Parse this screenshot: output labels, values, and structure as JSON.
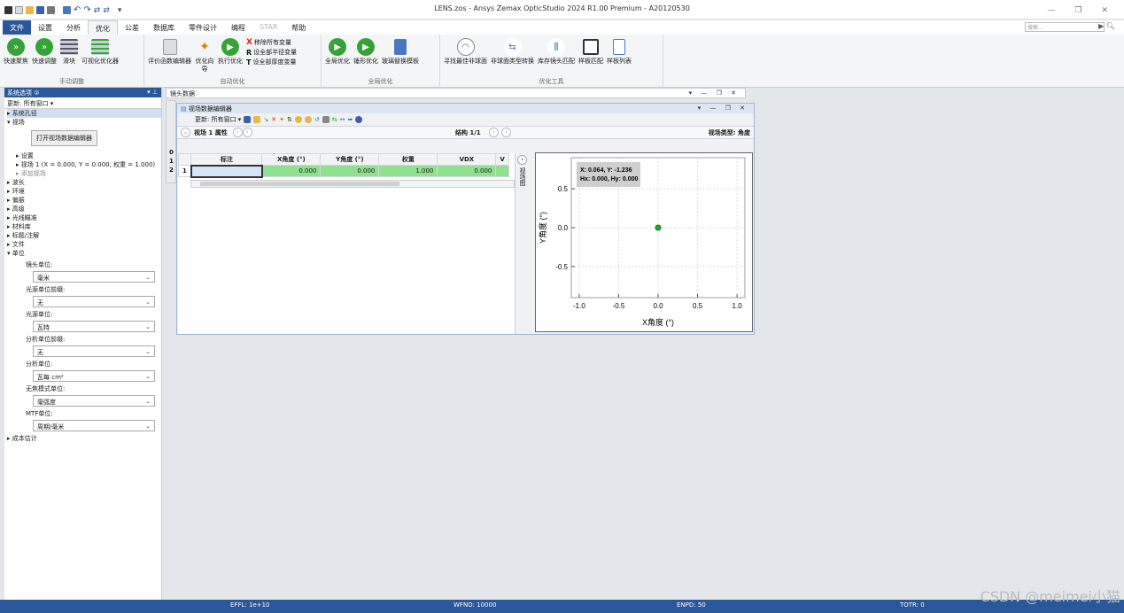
{
  "window": {
    "title": "LENS.zos - Ansys Zemax OpticStudio 2024 R1.00   Premium - A20120530"
  },
  "tabs": [
    "文件",
    "设置",
    "分析",
    "优化",
    "公差",
    "数据库",
    "零件设计",
    "编程",
    "STAR",
    "帮助"
  ],
  "search_placeholder": "搜索...",
  "ribbon": {
    "manual": {
      "name": "手动调整",
      "buttons": [
        "快速聚焦",
        "快速调整",
        "滑块",
        "可视化优化器"
      ]
    },
    "auto": {
      "name": "自动优化",
      "buttons": [
        "评价函数编辑器",
        "优化向导",
        "执行优化"
      ],
      "small": [
        "移除所有变量",
        "设全部半径变量",
        "设全部厚度变量"
      ]
    },
    "global": {
      "name": "全局优化",
      "buttons": [
        "全局优化",
        "锤形优化",
        "玻璃替换模板"
      ]
    },
    "tools": {
      "name": "优化工具",
      "buttons": [
        "寻找最佳非球面",
        "非球面类型转换",
        "库存镜头匹配",
        "样板匹配",
        "样板列表"
      ]
    }
  },
  "left_panel": {
    "header": "系统选项 ②",
    "update": "更新: 所有窗口 ▾",
    "tree": {
      "aperture": "系统孔径",
      "fields": "视场",
      "open_btn": "打开视场数据编辑器",
      "settings": "设置",
      "field1": "视场 1 (X = 0.000, Y = 0.000, 权重 = 1.000)",
      "add_field": "添加视场",
      "wavelength": "波长",
      "environment": "环境",
      "polarization": "偏振",
      "advanced": "高级",
      "ray_aiming": "光线瞄准",
      "material": "材料库",
      "title_notes": "标题/注解",
      "files": "文件",
      "units": "单位",
      "cost": "成本估计"
    },
    "units": [
      {
        "label": "镜头单位:",
        "value": "毫米"
      },
      {
        "label": "光源单位前缀:",
        "value": "无"
      },
      {
        "label": "光源单位:",
        "value": "瓦特"
      },
      {
        "label": "分析单位前缀:",
        "value": "无"
      },
      {
        "label": "分析单位:",
        "value": "瓦每 cm²"
      },
      {
        "label": "无焦模式单位:",
        "value": "毫弧度"
      },
      {
        "label": "MTF单位:",
        "value": "周期/毫米"
      }
    ]
  },
  "lens_data": {
    "title": "镜头数据"
  },
  "fde": {
    "title": "视场数据编辑器",
    "update": "更新: 所有窗口 ▾",
    "nav_left": "视场  1 属性",
    "nav_mid": "结构 1/1",
    "nav_right": "视场类型: 角度",
    "headers": [
      "标注",
      "X角度 (°)",
      "Y角度 (°)",
      "权重",
      "VDX",
      "V"
    ],
    "row": {
      "num": "1",
      "x": "0.000",
      "y": "0.000",
      "w": "1.000",
      "vdx": "0.000"
    },
    "side_tab": "视场图",
    "under_rows": [
      "0",
      "1",
      "2"
    ]
  },
  "plot": {
    "tooltip1": "X: 0.064,  Y: -1.236",
    "tooltip2": "Hx: 0.000, Hy: 0.000",
    "xlabel": "X角度 (°)",
    "ylabel": "Y角度 (°)",
    "xticks": [
      "-1.0",
      "-0.5",
      "0.0",
      "0.5",
      "1.0"
    ],
    "yticks": [
      "0.5",
      "0.0",
      "-0.5"
    ]
  },
  "chart_data": {
    "type": "scatter",
    "x": [
      0.0
    ],
    "y": [
      0.0
    ],
    "xlim": [
      -1.1,
      1.1
    ],
    "ylim": [
      -0.9,
      0.9
    ],
    "xlabel": "X角度 (°)",
    "ylabel": "Y角度 (°)"
  },
  "status": {
    "effl": "EFFL: 1e+10",
    "wfno": "WFNO: 10000",
    "enpd": "ENPD: 50",
    "totr": "TOTR: 0"
  },
  "watermark": "CSDN @meimei小猫"
}
